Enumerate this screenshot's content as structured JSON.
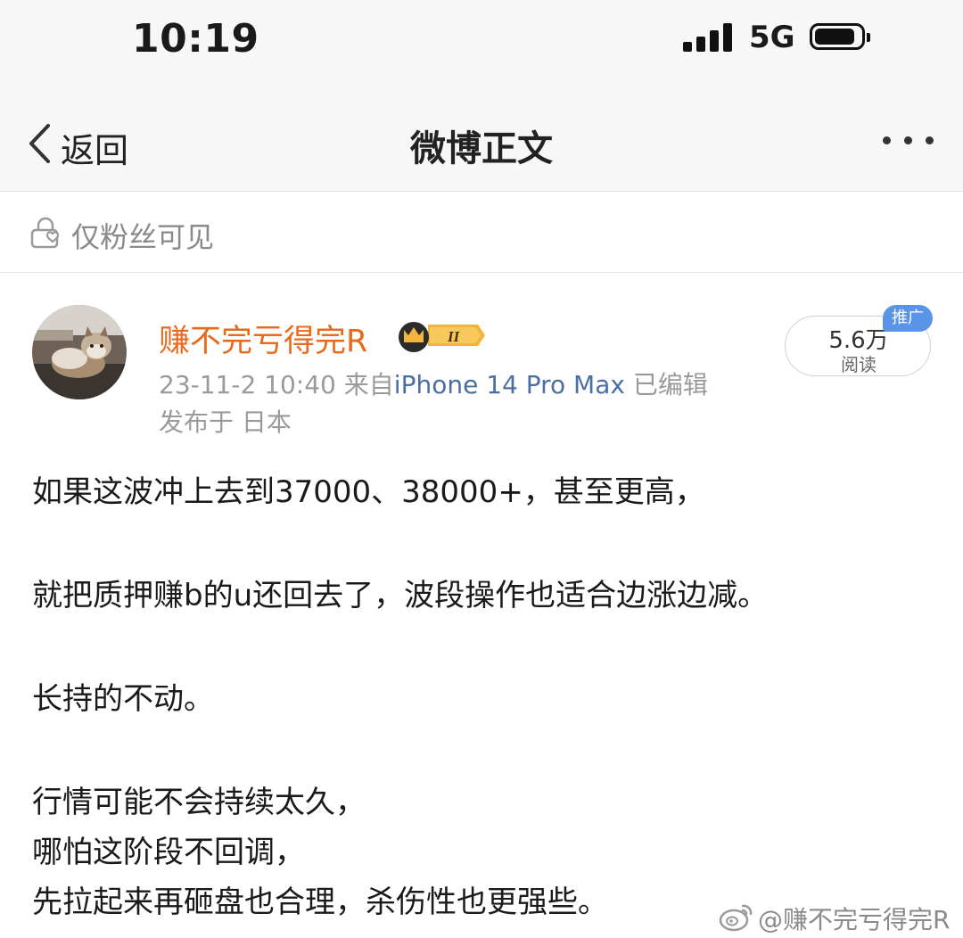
{
  "status_bar": {
    "time": "10:19",
    "network": "5G",
    "signal_bars": 4
  },
  "nav": {
    "back_label": "返回",
    "title": "微博正文",
    "more_icon": "more-dots-icon"
  },
  "visibility": {
    "icon": "fans-only-lock-icon",
    "label": "仅粉丝可见"
  },
  "post": {
    "author": "赚不完亏得完R",
    "badge": "II",
    "timestamp": "23-11-2 10:40",
    "source_prefix": "来自",
    "source": "iPhone 14 Pro Max",
    "edited": "已编辑",
    "location": "发布于 日本",
    "read_count": "5.6万",
    "read_label": "阅读",
    "promo_tag": "推广",
    "lines": [
      "如果这波冲上去到37000、38000+，甚至更高，",
      "就把质押赚b的u还回去了，波段操作也适合边涨边减。",
      "长持的不动。",
      "行情可能不会持续太久，",
      "哪怕这阶段不回调，",
      "先拉起来再砸盘也合理，杀伤性也更强些。"
    ]
  },
  "watermark": {
    "icon": "weibo-logo-icon",
    "text": "@赚不完亏得完R"
  },
  "colors": {
    "username": "#e86a1c",
    "source_link": "#4a6fa5",
    "meta": "#9a9a9a",
    "promo_tag": "#5a94e6",
    "nav_background": "#f7f7f7"
  }
}
